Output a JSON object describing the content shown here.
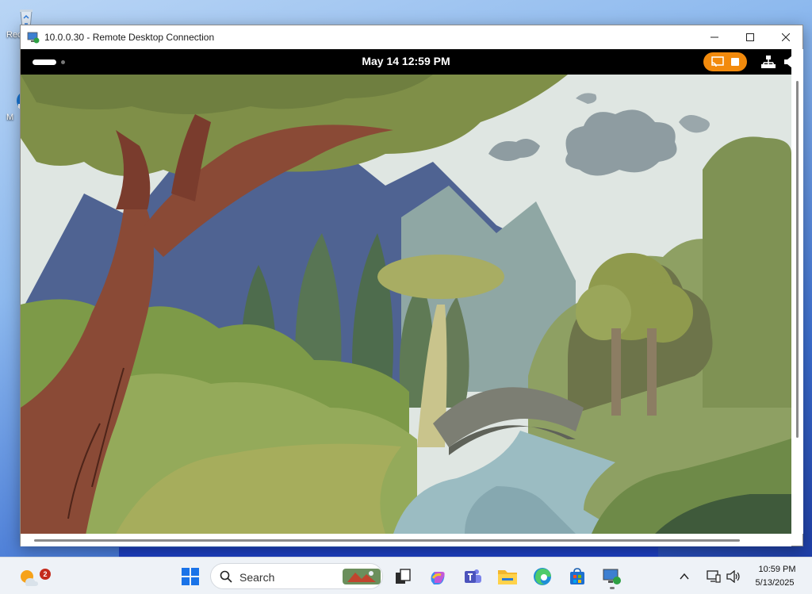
{
  "desktop": {
    "icons": [
      {
        "label": "Rec",
        "icon": "recycle-bin-icon"
      },
      {
        "label": "M",
        "icon": "shortcut-icon"
      }
    ]
  },
  "window": {
    "title": "10.0.0.30 - Remote Desktop Connection",
    "icon": "remote-desktop-icon",
    "controls": [
      "minimize-icon",
      "maximize-icon",
      "close-icon"
    ]
  },
  "remote": {
    "topbar": {
      "clock": "May 14  12:59 PM",
      "indicators": [
        "screencast-icon",
        "stop-icon",
        "network-icon",
        "volume-icon"
      ]
    },
    "wallpaper": "storybook forest landscape with tree, mountains, river and stone bridge"
  },
  "taskbar": {
    "weather_badge": "2",
    "search_placeholder": "Search",
    "apps": [
      "start-icon",
      "task-view-icon",
      "copilot-icon",
      "teams-icon",
      "file-explorer-icon",
      "edge-icon",
      "store-icon",
      "remote-desktop-icon"
    ],
    "tray": {
      "time": "10:59 PM",
      "date": "5/13/2025"
    }
  },
  "colors": {
    "accent_orange": "#f28a0c",
    "taskbar_bg": "#eef2f7"
  }
}
